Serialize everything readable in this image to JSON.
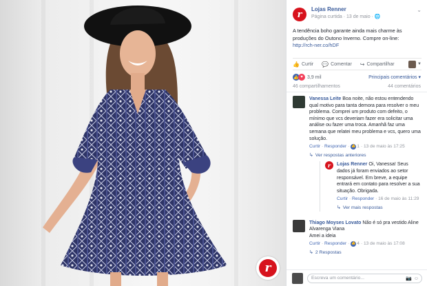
{
  "brand_color": "#d7131d",
  "photo": {
    "alt_icon": "renner-logo-badge"
  },
  "post": {
    "page_name": "Lojas Renner",
    "subtitle": "Página curtida · 13 de maio ·",
    "globe_icon": "globe-icon",
    "text": "A tendência boho garante ainda mais charme às produções do Outono Inverno. Compre on-line:",
    "link": "http://rch-ner.co/hDF"
  },
  "actions": {
    "like": "Curtir",
    "comment": "Comentar",
    "share": "Compartilhar"
  },
  "reactions": {
    "count": "3,9 mil",
    "relevance": "Principais comentários ▾"
  },
  "counts": {
    "shares": "46 compartilhamentos",
    "comments": "44 comentários"
  },
  "comments": [
    {
      "name": "Vanessa Leite",
      "text": "Boa noite, não estou entendendo qual motivo para tanta demora para resolver o meu problema. Comprei um produto com defeito, o mínimo que vcs deveriam fazer era solicitar uma análise ou fazer uma troca. Amanhã faz uma semana que relatei meu problema e vcs, quero uma solução.",
      "like": "Curtir",
      "reply": "Responder",
      "likes": "1",
      "time": "13 de maio às 17:25",
      "more": "Ver respostas anteriores",
      "reply_item": {
        "name": "Lojas Renner",
        "text": "Oi, Vanessa! Seus dados já foram enviados ao setor responsável. Em breve, a equipe entrará em contato para resolver a sua situação. Obrigada.",
        "like": "Curtir",
        "reply": "Responder",
        "time": "16 de maio às 11:29"
      },
      "more_replies": "Ver mais respostas"
    },
    {
      "name": "Thiago Moyses Lovato",
      "text": "Não é só pra vestido Aline Alvarenga Viana",
      "text2": "Amei a ideia",
      "like": "Curtir",
      "reply": "Responder",
      "likes": "4",
      "time": "13 de maio às 17:08",
      "replies": "2 Respostas"
    }
  ],
  "compose": {
    "placeholder": "Escreva um comentário..."
  }
}
